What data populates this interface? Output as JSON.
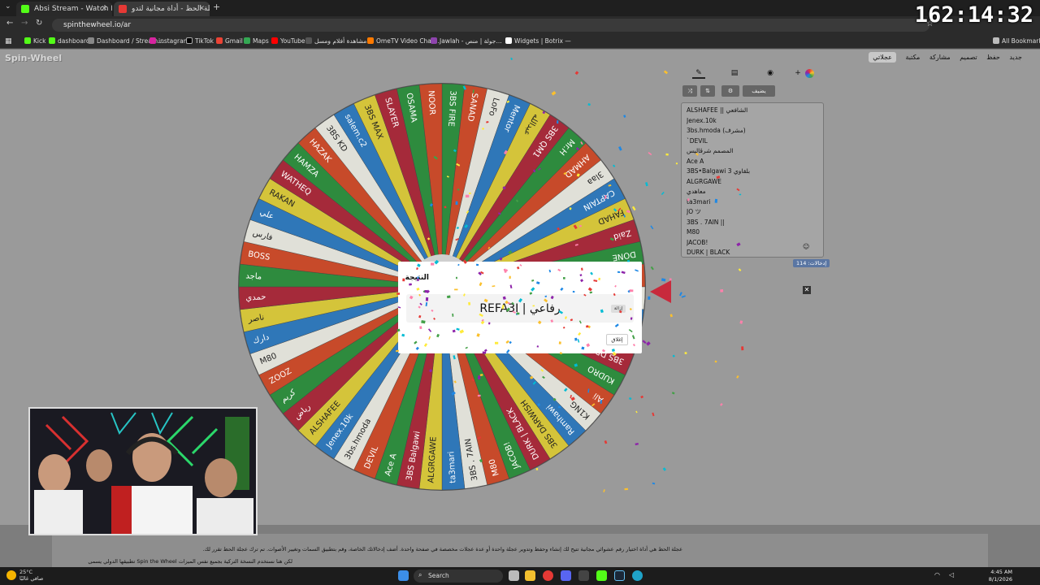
{
  "browser": {
    "tabs": [
      {
        "label": "Absi Stream - Watch Live on Ki",
        "color": "#53fc18"
      },
      {
        "label": "عجلة الحظ - أداة مجانية لتدو...",
        "color": "#e53935"
      }
    ],
    "url": "spinthewheel.io/ar",
    "bookmarks": [
      "Kick",
      "dashboard",
      "Dashboard / Stream...",
      "instagram",
      "TikTok",
      "Gmail",
      "Maps",
      "YouTube",
      "مشاهدة أفلام ومسل...",
      "OmeTV Video Chat...",
      "Jawlah - جولة | منص...",
      "Widgets | Botrix —"
    ],
    "all_bookmarks": "All Bookmarks"
  },
  "overlay_clock": "162:14:32",
  "site": {
    "logo": "Spin-Wheel",
    "nav": [
      "جديد",
      "حفظ",
      "تصميم",
      "مشاركة",
      "مكتبة",
      "عجلاتي"
    ]
  },
  "panel": {
    "tools": [
      "✎",
      "▤",
      "◉",
      "+"
    ],
    "tools2": [
      "⤨",
      "⇅",
      "⚙",
      "يضيف"
    ],
    "entries": [
      "ALSHAFEE || الشافعي",
      "Jenex.10k",
      "3bs.hmoda (مشرف)",
      "`DEVIL",
      "المصمم شرڤاليس",
      "Ace A",
      "3BS•Balgawi بلقاوي 3",
      "ALGRGAWE",
      "معاهدي",
      "ta3mari",
      "JO ツ",
      "3BS . 7AIN ||",
      "M80",
      "JACOB!",
      "DURK | BLACK"
    ],
    "count_label": "إدخالات: 114"
  },
  "wheel": {
    "colors": [
      "#2e8b3e",
      "#c74a2a",
      "#e0e0d8",
      "#2f77b8",
      "#d4c43a",
      "#a52a3a"
    ],
    "labels": [
      "3BS FIRE",
      "SANAD",
      "LoFo",
      "Mentor",
      "عبدالله",
      "3BS QM1",
      "Mr.H",
      "AHMAD",
      "3laa",
      "CAPTAIN",
      "FAHAD",
      "Zaid",
      "DONE",
      "3BS JOKAR",
      "عودة",
      "ريان",
      "ABADI",
      "3BS DRZ",
      "KUDRO",
      "Ali",
      "K1NG",
      "Ramhawi",
      "3BS DARWISH",
      "DURK | BLACK",
      "JACOB!",
      "M80",
      "3BS . 7AIN",
      "ta3mari",
      "ALGRGAWE",
      "3BS Balgawi",
      "Ace A",
      "DEVIL",
      "3bs.hmoda",
      "Jenex.10k",
      "ALSHAFEE",
      "رياض",
      "كريم",
      "ZOOZ",
      "M80",
      "دارك",
      "ناصر",
      "حمدي",
      "ماجد",
      "BOSS",
      "فارس",
      "علي",
      "RAKAN",
      "WATHEQ",
      "HAMZA",
      "HAZAK",
      "3BS KD",
      "salem.c2",
      "3BS MAX",
      "SLAYER",
      "OSAMA",
      "NOOR"
    ]
  },
  "result_modal": {
    "title": "النتيجة",
    "winner": "REFA3I | رفاعي",
    "remove": "إزالة",
    "close": "إغلاق"
  },
  "footer": {
    "line1": "عجلة الحظ هي أداة اختيار رقم عشوائي مجانية تتيح لك إنشاء وحفظ وتدوير عجلة واحدة أو عدة عجلات مخصصة في صفحة واحدة. أضف إدخالاتك الخاصة، وقم بتطبيق السمات وتغيير الأصوات. تم ترك عجلة الحظ تقرر لك.",
    "line2": "لكن هنا نستخدم النسخة التركية بجميع نفس الميزات Spin the Wheel تطبيقها الدولي يسمى"
  },
  "taskbar": {
    "search": "Search",
    "temp": "25°C",
    "weather": "صافي غالبًا",
    "time": "4:45 AM",
    "date": "8/1/2026"
  }
}
